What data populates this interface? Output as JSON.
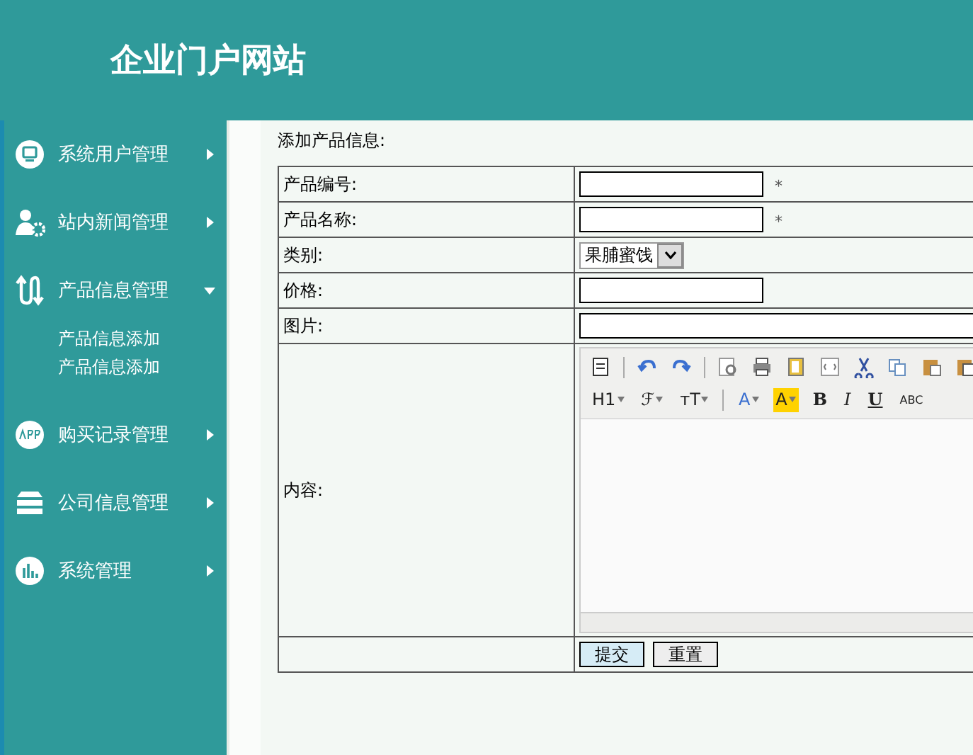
{
  "header": {
    "title": "企业门户网站"
  },
  "sidebar": {
    "items": [
      {
        "label": "系统用户管理",
        "expanded": false
      },
      {
        "label": "站内新闻管理",
        "expanded": false
      },
      {
        "label": "产品信息管理",
        "expanded": true,
        "children": [
          {
            "label": "产品信息添加"
          },
          {
            "label": "产品信息添加"
          }
        ]
      },
      {
        "label": "购买记录管理",
        "expanded": false
      },
      {
        "label": "公司信息管理",
        "expanded": false
      },
      {
        "label": "系统管理",
        "expanded": false
      }
    ]
  },
  "form": {
    "heading": "添加产品信息:",
    "rows": [
      {
        "label": "产品编号:",
        "kind": "text",
        "required_mark": "*"
      },
      {
        "label": "产品名称:",
        "kind": "text",
        "required_mark": "*"
      },
      {
        "label": "类别:",
        "kind": "select",
        "value": "果脯蜜饯"
      },
      {
        "label": "价格:",
        "kind": "text"
      },
      {
        "label": "图片:",
        "kind": "wide"
      },
      {
        "label": "内容:",
        "kind": "editor"
      }
    ],
    "editor_format_buttons": [
      {
        "label": "H1",
        "kind": "dropdown"
      },
      {
        "label": "ℱ",
        "kind": "dropdown"
      },
      {
        "label": "тT",
        "kind": "dropdown"
      },
      {
        "label": "A",
        "kind": "color"
      },
      {
        "label": "A",
        "kind": "highlight"
      },
      {
        "label": "B",
        "kind": "bold"
      },
      {
        "label": "I",
        "kind": "italic"
      },
      {
        "label": "U",
        "kind": "underline"
      },
      {
        "label": "ABC",
        "kind": "strike"
      }
    ],
    "buttons": [
      {
        "label": "提交",
        "kind": "submit"
      },
      {
        "label": "重置",
        "kind": "reset"
      }
    ]
  }
}
